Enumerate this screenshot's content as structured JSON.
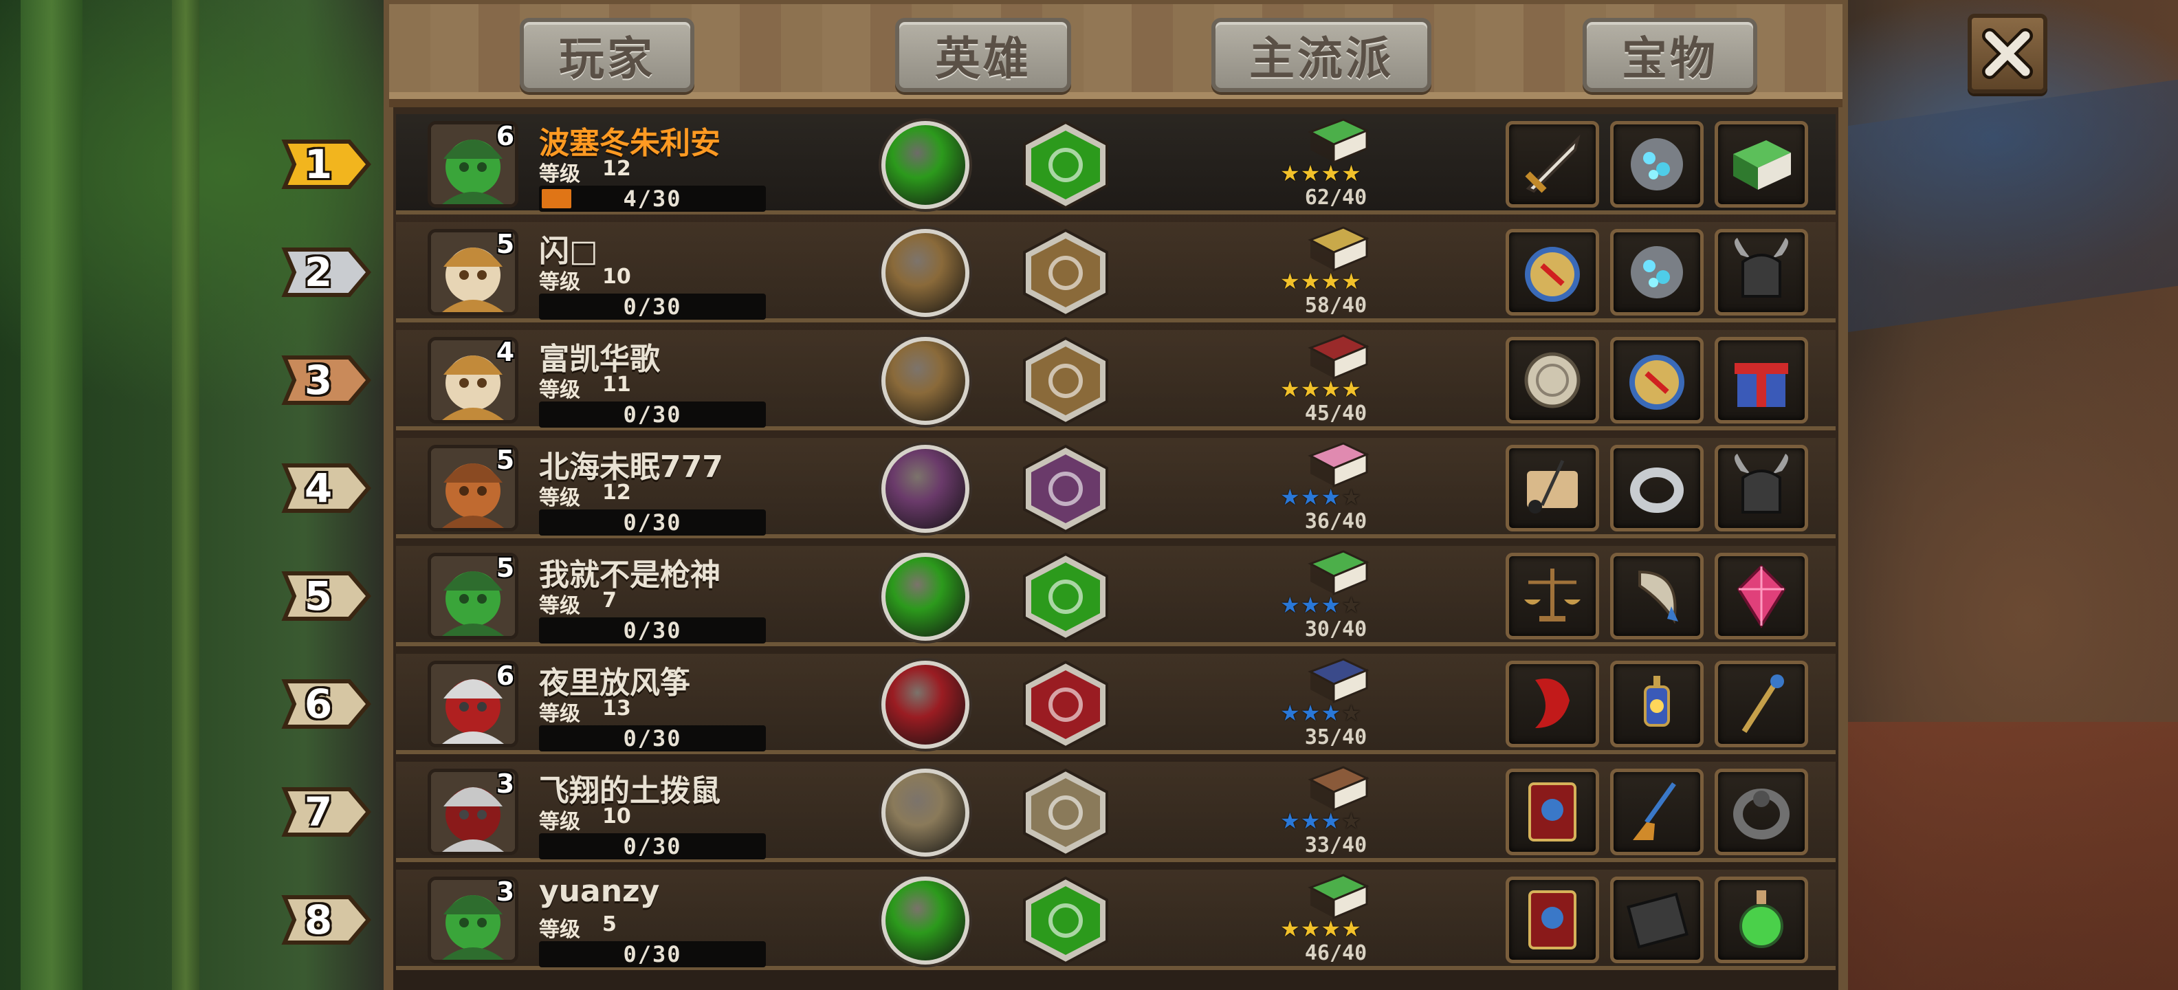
{
  "header": {
    "tabs": [
      "玩家",
      "英雄",
      "主流派",
      "宝物"
    ]
  },
  "level_label": "等级",
  "rows": [
    {
      "rank": "1",
      "rank_color": "#f2b51e",
      "name": "波塞冬朱利安",
      "highlight": true,
      "hero_level": "6",
      "level": "12",
      "progress": "4/30",
      "progress_fraction": 0.133,
      "hero_icon": "green-orc-hero-icon",
      "skill_color": "#2c9a1c",
      "book_color": "#4caf4a",
      "stars": 4,
      "star_color": "#f2c12a",
      "count": "62/40",
      "items": [
        "sword-icon",
        "crystal-ore-icon",
        "green-book-icon"
      ]
    },
    {
      "rank": "2",
      "rank_color": "#c9ccd0",
      "name": "闪□",
      "highlight": false,
      "hero_level": "5",
      "level": "10",
      "progress": "0/30",
      "progress_fraction": 0,
      "hero_icon": "panda-monk-hero-icon",
      "skill_color": "#8a6a3a",
      "book_color": "#c9a94a",
      "stars": 4,
      "star_color": "#f2c12a",
      "count": "58/40",
      "items": [
        "compass-icon",
        "crystal-ore-icon",
        "horned-helmet-icon"
      ]
    },
    {
      "rank": "3",
      "rank_color": "#c98a5a",
      "name": "富凯华歌",
      "highlight": false,
      "hero_level": "4",
      "level": "11",
      "progress": "0/30",
      "progress_fraction": 0,
      "hero_icon": "panda-monk-hero-icon",
      "skill_color": "#8a6a3a",
      "book_color": "#9a2a2a",
      "stars": 4,
      "star_color": "#f2c12a",
      "count": "45/40",
      "items": [
        "coin-icon",
        "compass-icon",
        "gift-box-icon"
      ]
    },
    {
      "rank": "4",
      "rank_color": "#d6c6a3",
      "name": "北海未眠777",
      "highlight": false,
      "hero_level": "5",
      "level": "12",
      "progress": "0/30",
      "progress_fraction": 0,
      "hero_icon": "tree-ent-hero-icon",
      "skill_color": "#6a3a6a",
      "book_color": "#e08ab0",
      "stars": 3,
      "star_color": "#2a78d8",
      "count": "36/40",
      "items": [
        "scroll-quill-icon",
        "ring-icon",
        "horned-helmet-icon"
      ]
    },
    {
      "rank": "5",
      "rank_color": "#d6c6a3",
      "name": "我就不是枪神",
      "highlight": false,
      "hero_level": "5",
      "level": "7",
      "progress": "0/30",
      "progress_fraction": 0,
      "hero_icon": "green-orc-hero-icon",
      "skill_color": "#2c9a1c",
      "book_color": "#4caf4a",
      "stars": 3,
      "star_color": "#2a78d8",
      "count": "30/40",
      "items": [
        "scales-icon",
        "horn-icon",
        "red-gem-icon"
      ]
    },
    {
      "rank": "6",
      "rank_color": "#d6c6a3",
      "name": "夜里放风筝",
      "highlight": false,
      "hero_level": "6",
      "level": "13",
      "progress": "0/30",
      "progress_fraction": 0,
      "hero_icon": "white-hair-ninja-hero-icon",
      "skill_color": "#9a1c22",
      "book_color": "#3a4a8a",
      "stars": 3,
      "star_color": "#2a78d8",
      "count": "35/40",
      "items": [
        "red-claw-icon",
        "lantern-icon",
        "staff-icon"
      ]
    },
    {
      "rank": "7",
      "rank_color": "#d6c6a3",
      "name": "飞翔的土拨鼠",
      "highlight": false,
      "hero_level": "3",
      "level": "10",
      "progress": "0/30",
      "progress_fraction": 0,
      "hero_icon": "knight-hero-icon",
      "skill_color": "#8a7a5a",
      "book_color": "#8a5a3a",
      "stars": 3,
      "star_color": "#2a78d8",
      "count": "33/40",
      "items": [
        "blue-star-book-icon",
        "broom-icon",
        "iron-ring-icon"
      ]
    },
    {
      "rank": "8",
      "rank_color": "#d6c6a3",
      "name": "yuanzy",
      "highlight": false,
      "hero_level": "3",
      "level": "5",
      "progress": "0/30",
      "progress_fraction": 0,
      "hero_icon": "green-orc-hero-icon",
      "skill_color": "#2c9a1c",
      "book_color": "#4caf4a",
      "stars": 4,
      "star_color": "#f2c12a",
      "count": "46/40",
      "items": [
        "blue-star-book-icon",
        "dark-tablet-icon",
        "green-potion-icon"
      ]
    }
  ]
}
